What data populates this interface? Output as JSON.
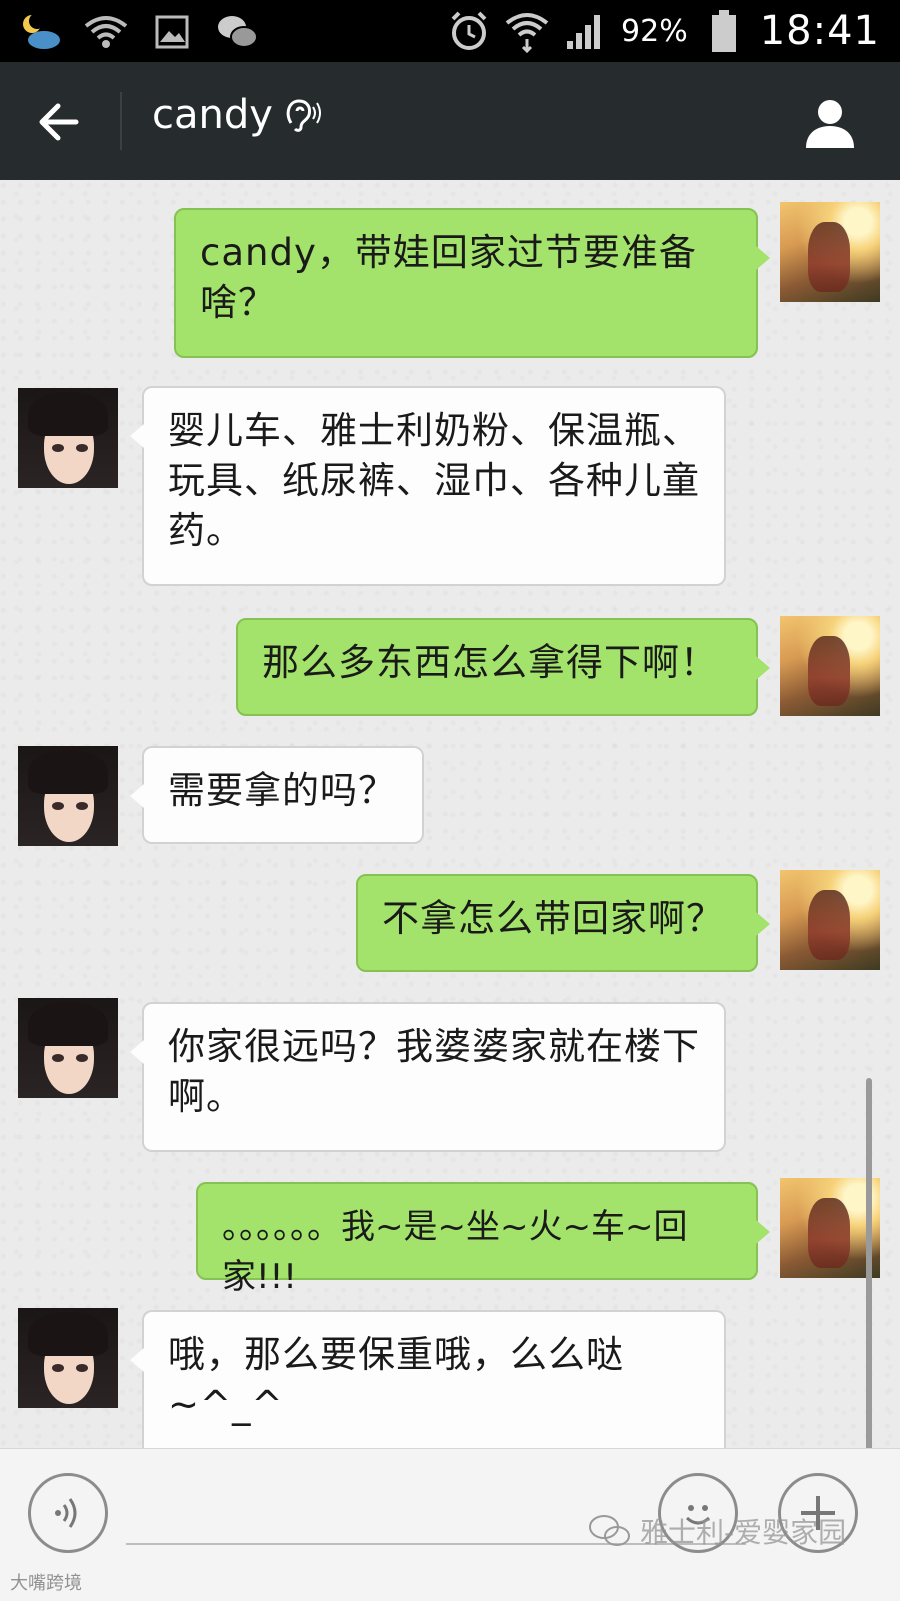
{
  "status_bar": {
    "battery_percent": "92%",
    "time": "18:41",
    "icons": [
      "weather-night-icon",
      "wifi-icon",
      "image-icon",
      "wechat-icon",
      "alarm-icon",
      "wifi-signal-icon",
      "cell-signal-icon",
      "battery-icon"
    ]
  },
  "header": {
    "title": "candy",
    "icons": [
      "back-arrow-icon",
      "ear-icon",
      "profile-icon"
    ]
  },
  "messages": [
    {
      "sender": "me",
      "text": "candy，带娃回家过节要准备啥？"
    },
    {
      "sender": "her",
      "text": "婴儿车、雅士利奶粉、保温瓶、玩具、纸尿裤、湿巾、各种儿童药。"
    },
    {
      "sender": "me",
      "text": "那么多东西怎么拿得下啊！"
    },
    {
      "sender": "her",
      "text": "需要拿的吗？"
    },
    {
      "sender": "me",
      "text": "不拿怎么带回家啊？"
    },
    {
      "sender": "her",
      "text": "你家很远吗？我婆婆家就在楼下啊。"
    },
    {
      "sender": "me",
      "text": "。。。。。。我~是~坐~火~车~回家!!!"
    },
    {
      "sender": "her",
      "text": "哦，那么要保重哦，么么哒~^_^"
    }
  ],
  "input_bar": {
    "placeholder": "",
    "icons": [
      "voice-icon",
      "emoji-icon",
      "plus-icon"
    ]
  },
  "watermark": {
    "text": "雅士利-爱婴家园",
    "text2": "大嘴跨境"
  }
}
